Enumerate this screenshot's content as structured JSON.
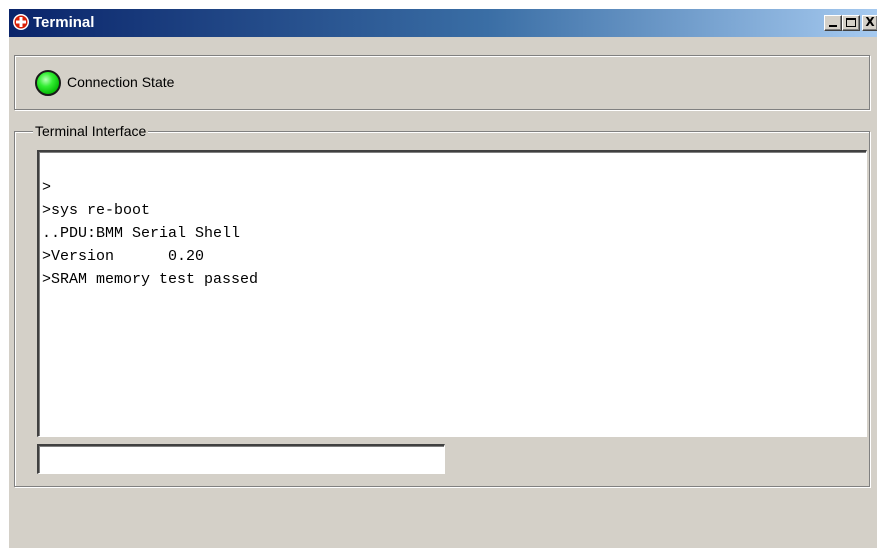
{
  "window": {
    "title": "Terminal",
    "app_icon": "app-logo-icon",
    "controls": {
      "minimize_icon": "minimize-icon",
      "maximize_icon": "maximize-icon",
      "close_label": "X"
    }
  },
  "connection": {
    "label": "Connection State",
    "status_icon": "led-indicator-icon",
    "status_color": "#33ee33"
  },
  "terminal": {
    "group_title": "Terminal Interface",
    "lines": [
      ">",
      ">sys re-boot",
      "..PDU:BMM Serial Shell",
      ">Version      0.20",
      ">SRAM memory test passed"
    ],
    "input_value": "",
    "input_placeholder": ""
  },
  "colors": {
    "titlebar_start": "#0a246a",
    "titlebar_end": "#a6caf0",
    "window_bg": "#d4d0c8",
    "led_green": "#33ee33"
  }
}
